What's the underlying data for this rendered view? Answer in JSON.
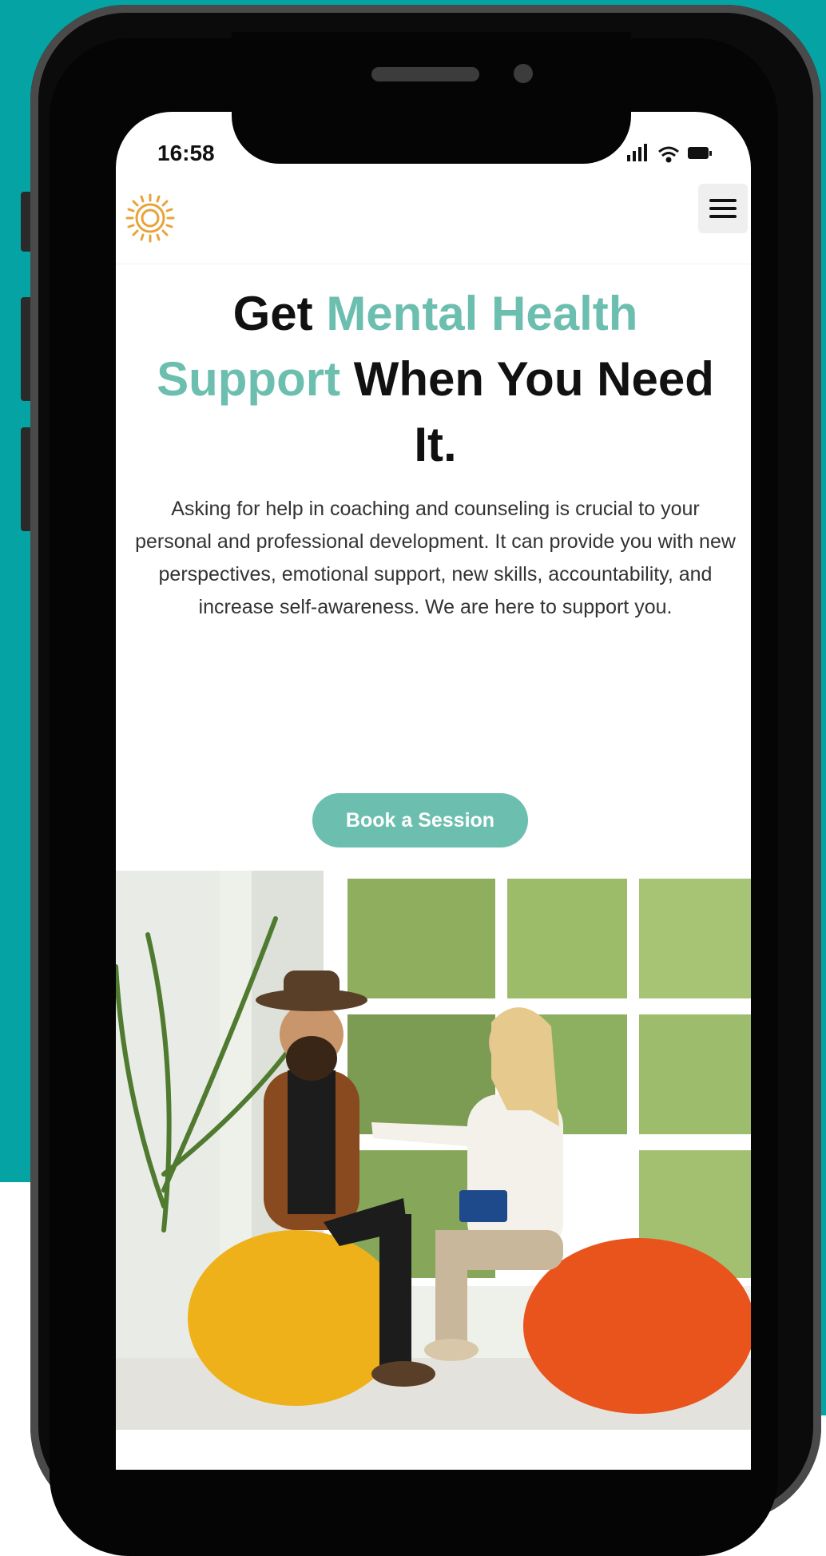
{
  "status_bar": {
    "time": "16:58",
    "icons": [
      "signal-icon",
      "wifi-icon",
      "battery-icon"
    ]
  },
  "header": {
    "logo": "sun-logo",
    "menu_icon": "hamburger-menu-icon"
  },
  "hero": {
    "title_part1": "Get ",
    "title_accent": "Mental Health Support",
    "title_part2": " When You Need It.",
    "body": "Asking for help in coaching and counseling is crucial to your personal and professional development. It can provide you with new perspectives, emotional support, new skills, accountability, and increase self-awareness. We are here to support you.",
    "cta_label": "Book a Session"
  },
  "colors": {
    "accent": "#6cbeaf",
    "background_teal": "#05a3a3",
    "logo_orange": "#e8a33a"
  }
}
